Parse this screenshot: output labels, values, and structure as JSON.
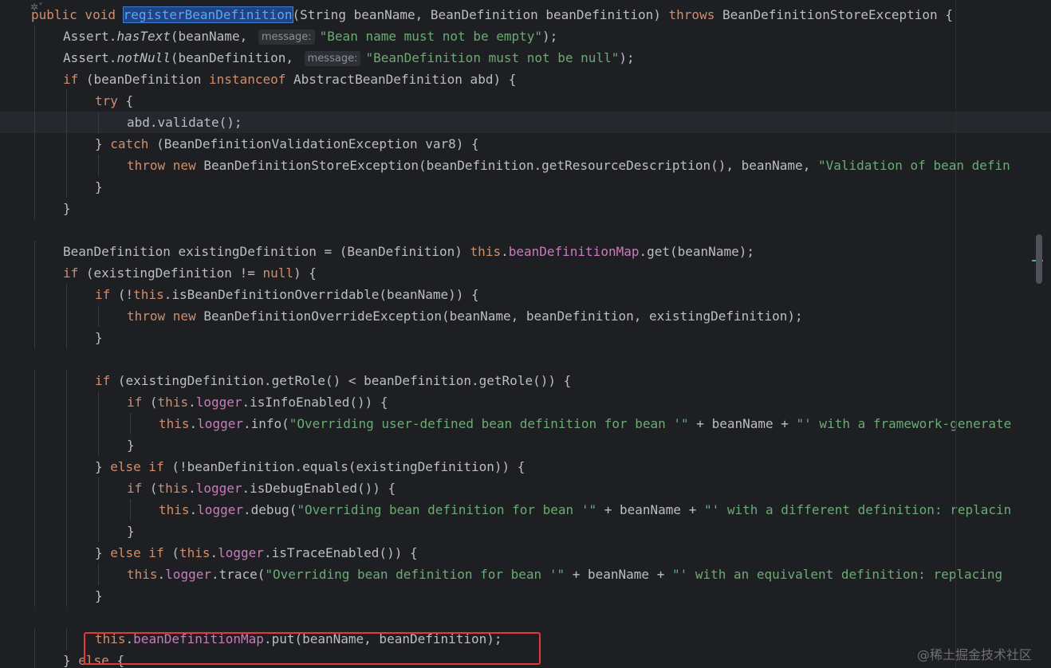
{
  "watermark": "@稀土掘金技术社区",
  "gutter_icon": "code-lens-icon",
  "lines": [
    {
      "indent": 0,
      "tokens": [
        {
          "k": "kw",
          "t": "public void "
        },
        {
          "k": "sel",
          "t": "registerBeanDefinition"
        },
        {
          "k": "plain",
          "t": "(String beanName, BeanDefinition beanDefinition) "
        },
        {
          "k": "kw",
          "t": "throws "
        },
        {
          "k": "plain",
          "t": "BeanDefinitionStoreException {"
        }
      ]
    },
    {
      "indent": 1,
      "tokens": [
        {
          "k": "plain",
          "t": "Assert."
        },
        {
          "k": "italic",
          "t": "hasText"
        },
        {
          "k": "plain",
          "t": "(beanName, "
        },
        {
          "k": "hint",
          "t": "message:"
        },
        {
          "k": "str",
          "t": "\"Bean name must not be empty\""
        },
        {
          "k": "plain",
          "t": ");"
        }
      ]
    },
    {
      "indent": 1,
      "tokens": [
        {
          "k": "plain",
          "t": "Assert."
        },
        {
          "k": "italic",
          "t": "notNull"
        },
        {
          "k": "plain",
          "t": "(beanDefinition, "
        },
        {
          "k": "hint",
          "t": "message:"
        },
        {
          "k": "str",
          "t": "\"BeanDefinition must not be null\""
        },
        {
          "k": "plain",
          "t": ");"
        }
      ]
    },
    {
      "indent": 1,
      "tokens": [
        {
          "k": "kw",
          "t": "if "
        },
        {
          "k": "plain",
          "t": "(beanDefinition "
        },
        {
          "k": "kw",
          "t": "instanceof "
        },
        {
          "k": "plain",
          "t": "AbstractBeanDefinition abd) {"
        }
      ]
    },
    {
      "indent": 2,
      "tokens": [
        {
          "k": "kw",
          "t": "try "
        },
        {
          "k": "plain",
          "t": "{"
        }
      ]
    },
    {
      "indent": 3,
      "current": true,
      "tokens": [
        {
          "k": "plain",
          "t": "abd.validate();"
        }
      ]
    },
    {
      "indent": 2,
      "tokens": [
        {
          "k": "plain",
          "t": "} "
        },
        {
          "k": "kw",
          "t": "catch "
        },
        {
          "k": "plain",
          "t": "(BeanDefinitionValidationException var8) {"
        }
      ]
    },
    {
      "indent": 3,
      "tokens": [
        {
          "k": "kw",
          "t": "throw new "
        },
        {
          "k": "plain",
          "t": "BeanDefinitionStoreException(beanDefinition.getResourceDescription(), beanName, "
        },
        {
          "k": "str",
          "t": "\"Validation of bean defin"
        }
      ]
    },
    {
      "indent": 2,
      "tokens": [
        {
          "k": "plain",
          "t": "}"
        }
      ]
    },
    {
      "indent": 1,
      "tokens": [
        {
          "k": "plain",
          "t": "}"
        }
      ]
    },
    {
      "indent": 0,
      "tokens": []
    },
    {
      "indent": 1,
      "tokens": [
        {
          "k": "plain",
          "t": "BeanDefinition existingDefinition = (BeanDefinition) "
        },
        {
          "k": "kw",
          "t": "this"
        },
        {
          "k": "plain",
          "t": "."
        },
        {
          "k": "field",
          "t": "beanDefinitionMap"
        },
        {
          "k": "plain",
          "t": ".get(beanName);"
        }
      ]
    },
    {
      "indent": 1,
      "tokens": [
        {
          "k": "kw",
          "t": "if "
        },
        {
          "k": "plain",
          "t": "(existingDefinition != "
        },
        {
          "k": "kw",
          "t": "null"
        },
        {
          "k": "plain",
          "t": ") {"
        }
      ]
    },
    {
      "indent": 2,
      "tokens": [
        {
          "k": "kw",
          "t": "if "
        },
        {
          "k": "plain",
          "t": "(!"
        },
        {
          "k": "kw",
          "t": "this"
        },
        {
          "k": "plain",
          "t": ".isBeanDefinitionOverridable(beanName)) {"
        }
      ]
    },
    {
      "indent": 3,
      "tokens": [
        {
          "k": "kw",
          "t": "throw new "
        },
        {
          "k": "plain",
          "t": "BeanDefinitionOverrideException(beanName, beanDefinition, existingDefinition);"
        }
      ]
    },
    {
      "indent": 2,
      "tokens": [
        {
          "k": "plain",
          "t": "}"
        }
      ]
    },
    {
      "indent": 0,
      "tokens": []
    },
    {
      "indent": 2,
      "tokens": [
        {
          "k": "kw",
          "t": "if "
        },
        {
          "k": "plain",
          "t": "(existingDefinition.getRole() < beanDefinition.getRole()) {"
        }
      ]
    },
    {
      "indent": 3,
      "tokens": [
        {
          "k": "kw",
          "t": "if "
        },
        {
          "k": "plain",
          "t": "("
        },
        {
          "k": "kw",
          "t": "this"
        },
        {
          "k": "plain",
          "t": "."
        },
        {
          "k": "field",
          "t": "logger"
        },
        {
          "k": "plain",
          "t": ".isInfoEnabled()) {"
        }
      ]
    },
    {
      "indent": 4,
      "tokens": [
        {
          "k": "kw",
          "t": "this"
        },
        {
          "k": "plain",
          "t": "."
        },
        {
          "k": "field",
          "t": "logger"
        },
        {
          "k": "plain",
          "t": ".info("
        },
        {
          "k": "str",
          "t": "\"Overriding user-defined bean definition for bean '\""
        },
        {
          "k": "plain",
          "t": " + beanName + "
        },
        {
          "k": "str",
          "t": "\"' with a framework-generate"
        }
      ]
    },
    {
      "indent": 3,
      "tokens": [
        {
          "k": "plain",
          "t": "}"
        }
      ]
    },
    {
      "indent": 2,
      "tokens": [
        {
          "k": "plain",
          "t": "} "
        },
        {
          "k": "kw",
          "t": "else if "
        },
        {
          "k": "plain",
          "t": "(!beanDefinition.equals(existingDefinition)) {"
        }
      ]
    },
    {
      "indent": 3,
      "tokens": [
        {
          "k": "kw",
          "t": "if "
        },
        {
          "k": "plain",
          "t": "("
        },
        {
          "k": "kw",
          "t": "this"
        },
        {
          "k": "plain",
          "t": "."
        },
        {
          "k": "field",
          "t": "logger"
        },
        {
          "k": "plain",
          "t": ".isDebugEnabled()) {"
        }
      ]
    },
    {
      "indent": 4,
      "tokens": [
        {
          "k": "kw",
          "t": "this"
        },
        {
          "k": "plain",
          "t": "."
        },
        {
          "k": "field",
          "t": "logger"
        },
        {
          "k": "plain",
          "t": ".debug("
        },
        {
          "k": "str",
          "t": "\"Overriding bean definition for bean '\""
        },
        {
          "k": "plain",
          "t": " + beanName + "
        },
        {
          "k": "str",
          "t": "\"' with a different definition: replacin"
        }
      ]
    },
    {
      "indent": 3,
      "tokens": [
        {
          "k": "plain",
          "t": "}"
        }
      ]
    },
    {
      "indent": 2,
      "tokens": [
        {
          "k": "plain",
          "t": "} "
        },
        {
          "k": "kw",
          "t": "else if "
        },
        {
          "k": "plain",
          "t": "("
        },
        {
          "k": "kw",
          "t": "this"
        },
        {
          "k": "plain",
          "t": "."
        },
        {
          "k": "field",
          "t": "logger"
        },
        {
          "k": "plain",
          "t": ".isTraceEnabled()) {"
        }
      ]
    },
    {
      "indent": 3,
      "tokens": [
        {
          "k": "kw",
          "t": "this"
        },
        {
          "k": "plain",
          "t": "."
        },
        {
          "k": "field",
          "t": "logger"
        },
        {
          "k": "plain",
          "t": ".trace("
        },
        {
          "k": "str",
          "t": "\"Overriding bean definition for bean '\""
        },
        {
          "k": "plain",
          "t": " + beanName + "
        },
        {
          "k": "str",
          "t": "\"' with an equivalent definition: replacing"
        }
      ]
    },
    {
      "indent": 2,
      "tokens": [
        {
          "k": "plain",
          "t": "}"
        }
      ]
    },
    {
      "indent": 0,
      "tokens": []
    },
    {
      "indent": 2,
      "tokens": [
        {
          "k": "kw",
          "t": "this"
        },
        {
          "k": "plain",
          "t": "."
        },
        {
          "k": "field",
          "t": "beanDefinitionMap"
        },
        {
          "k": "plain",
          "t": ".put(beanName, beanDefinition);"
        }
      ]
    },
    {
      "indent": 1,
      "tokens": [
        {
          "k": "plain",
          "t": "} "
        },
        {
          "k": "kw",
          "t": "else "
        },
        {
          "k": "plain",
          "t": "{"
        }
      ]
    }
  ]
}
